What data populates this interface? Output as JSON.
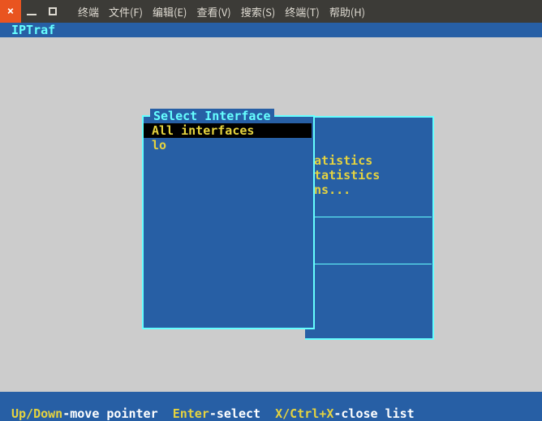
{
  "window": {
    "menu": [
      "终端",
      "文件(F)",
      "编辑(E)",
      "查看(V)",
      "搜索(S)",
      "终端(T)",
      "帮助(H)"
    ]
  },
  "app": {
    "title": "IPTraf"
  },
  "select_box": {
    "title": "Select Interface",
    "items": [
      {
        "label": "All interfaces",
        "selected": true
      },
      {
        "label": "lo",
        "selected": false
      }
    ]
  },
  "background_panel": {
    "lines": [
      "tatistics",
      "statistics",
      "wns..."
    ]
  },
  "footer": {
    "updown": "Up/Down",
    "move": "-move pointer",
    "enter": "Enter",
    "select": "-select",
    "xkey": "X/Ctrl+X",
    "close": "-close list"
  }
}
